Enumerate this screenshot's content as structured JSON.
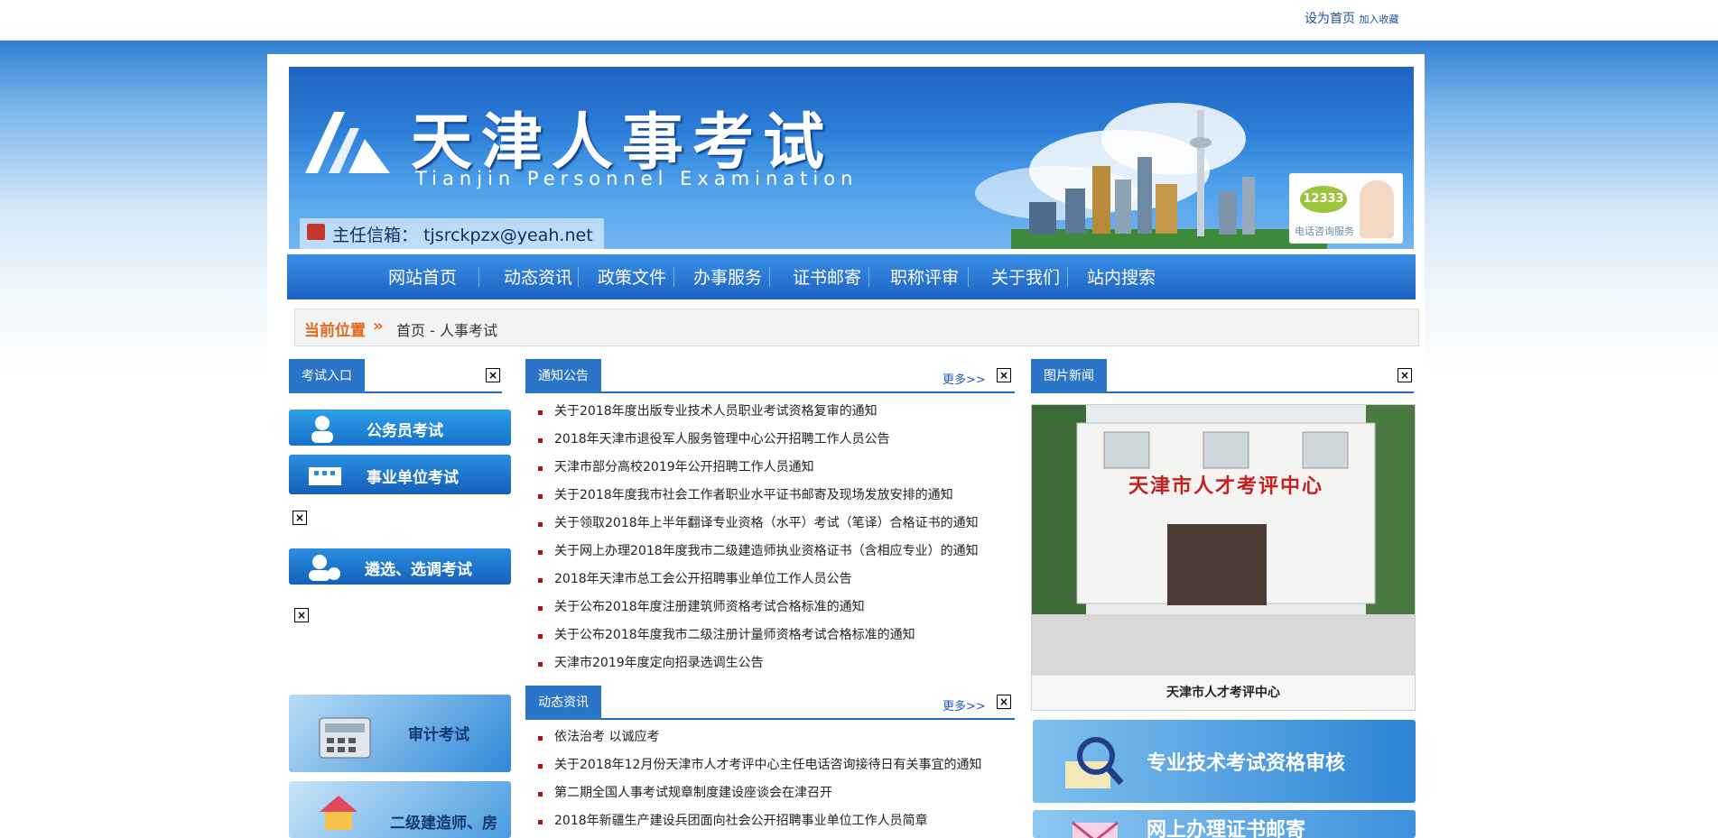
{
  "topbar": {
    "set_home": "设为首页",
    "favorite": "加入收藏"
  },
  "header": {
    "title_cn": "天津人事考试",
    "title_en": "Tianjin Personnel Examination",
    "email_label": "主任信箱：",
    "email": "tjsrckpzx@yeah.net",
    "hotline_number": "12333",
    "hotline_text": "电话咨询服务"
  },
  "nav": {
    "items": [
      "网站首页",
      "动态资讯",
      "政策文件",
      "办事服务",
      "证书邮寄",
      "职称评审",
      "关于我们",
      "站内搜索"
    ]
  },
  "breadcrumb": {
    "label": "当前位置",
    "path": "首页 - 人事考试"
  },
  "exam_entry": {
    "tab": "考试入口",
    "buttons": [
      "公务员考试",
      "事业单位考试",
      "遴选、选调考试"
    ],
    "bottom_buttons": [
      "审计考试",
      "二级建造师、房"
    ]
  },
  "notices": {
    "tab": "通知公告",
    "more": "更多>>",
    "items": [
      "关于2018年度出版专业技术人员职业考试资格复审的通知",
      "2018年天津市退役军人服务管理中心公开招聘工作人员公告",
      "天津市部分高校2019年公开招聘工作人员通知",
      "关于2018年度我市社会工作者职业水平证书邮寄及现场发放安排的通知",
      "关于领取2018年上半年翻译专业资格（水平）考试（笔译）合格证书的通知",
      "关于网上办理2018年度我市二级建造师执业资格证书（含相应专业）的通知",
      "2018年天津市总工会公开招聘事业单位工作人员公告",
      "关于公布2018年度注册建筑师资格考试合格标准的通知",
      "关于公布2018年度我市二级注册计量师资格考试合格标准的通知",
      "天津市2019年度定向招录选调生公告"
    ]
  },
  "news": {
    "tab": "动态资讯",
    "more": "更多>>",
    "items": [
      "依法治考 以诚应考",
      "关于2018年12月份天津市人才考评中心主任电话咨询接待日有关事宜的通知",
      "第二期全国人事考试规章制度建设座谈会在津召开",
      "2018年新疆生产建设兵团面向社会公开招聘事业单位工作人员简章"
    ]
  },
  "photo_news": {
    "tab": "图片新闻",
    "sign": "天津市人才考评中心",
    "caption": "天津市人才考评中心"
  },
  "side_banners": {
    "qualification": "专业技术考试资格审核",
    "mail": "网上办理证书邮寄"
  },
  "close_glyph": "×"
}
